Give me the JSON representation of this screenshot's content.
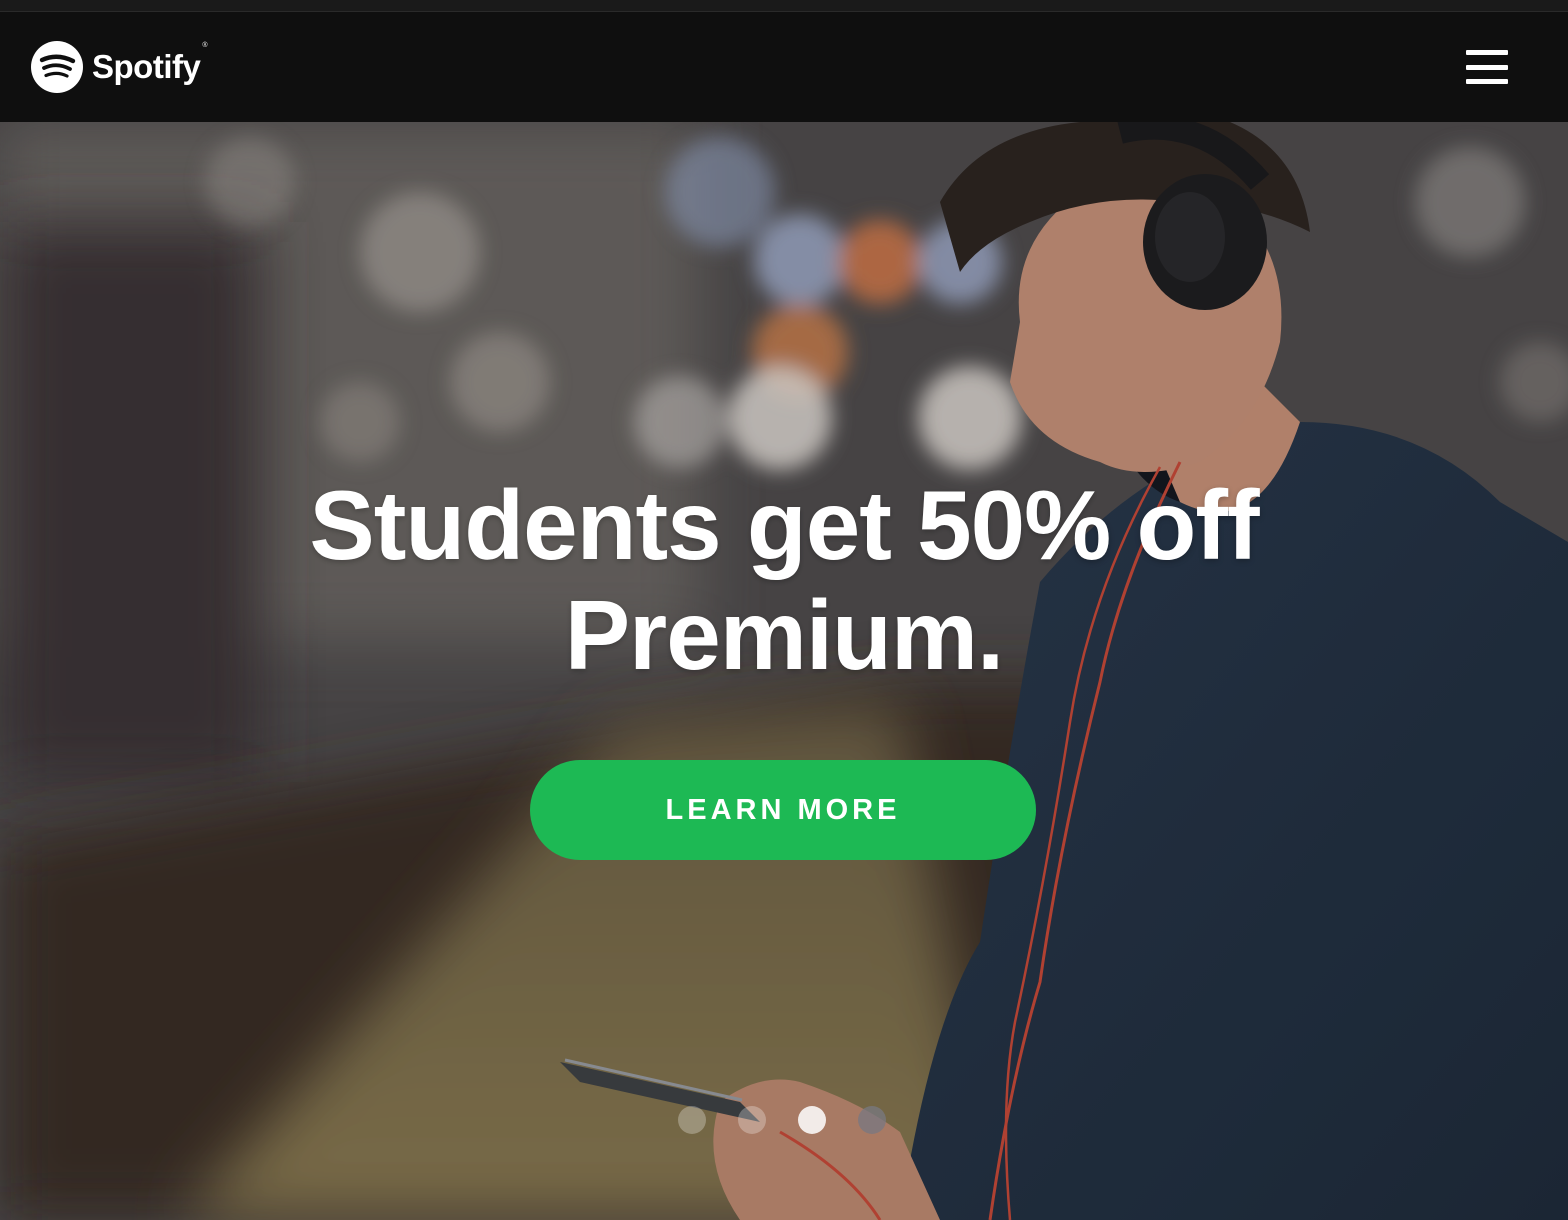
{
  "header": {
    "logo_text": "Spotify",
    "logo_tm": "®",
    "logo_icon": "spotify-logo-icon",
    "menu_icon": "hamburger-menu-icon"
  },
  "hero": {
    "headline_line1": "Students get 50% off",
    "headline_line2": "Premium.",
    "cta_label": "LEARN MORE",
    "slide_count": 4,
    "active_slide": 3
  },
  "colors": {
    "header_background": "#0f0f0f",
    "cta_background": "#1db954",
    "text": "#ffffff"
  }
}
